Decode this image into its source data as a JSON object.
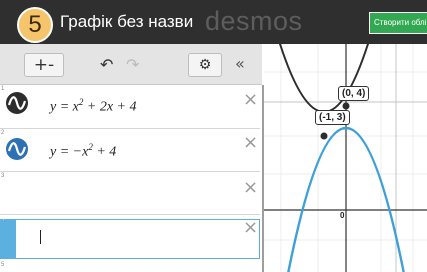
{
  "step_number": "5",
  "header": {
    "title": "Графік без назви",
    "brand": "desmos",
    "create_button_label": "Створити облік"
  },
  "toolbar": {
    "add_label": "+-",
    "undo_icon": "undo-arrow-icon",
    "redo_icon": "redo-arrow-icon",
    "settings_icon": "gear-icon",
    "collapse_icon": "double-chevron-left-icon"
  },
  "expressions": [
    {
      "number": "1",
      "latex": "y=x^2+2x+4",
      "color": "#2d2d2d",
      "icon": "graph-toggle-icon"
    },
    {
      "number": "2",
      "latex": "y=-x^2+4",
      "color": "#2d70b3",
      "icon": "graph-toggle-icon"
    },
    {
      "number": "3",
      "latex": ""
    },
    {
      "number": "4",
      "latex": "",
      "active": true
    },
    {
      "number": "5",
      "latex": ""
    }
  ],
  "graph": {
    "points": [
      {
        "label": "(0, 4)",
        "x": 0,
        "y": 4
      },
      {
        "label": "(-1, 3)",
        "x": -1,
        "y": 3
      }
    ],
    "axis_tick_label": "0",
    "curve_colors": {
      "parabola_up": "#2d2d2d",
      "parabola_down": "#3fa0d8"
    }
  },
  "colors": {
    "header_bg": "#2f2f2f",
    "create_button": "#32a852",
    "active_accent": "#5bb0e0",
    "badge": "#f5c46b"
  }
}
